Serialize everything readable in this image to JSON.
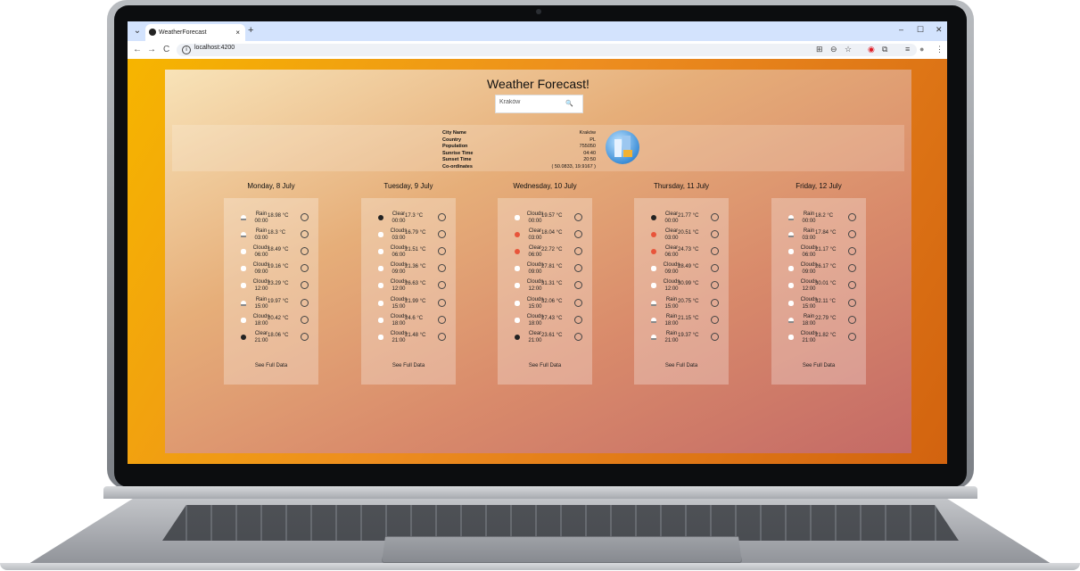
{
  "browser": {
    "tab_title": "WeatherForecast",
    "tab_close": "×",
    "new_tab": "+",
    "tab_menu": "⌄",
    "url": "localhost:4200",
    "back": "←",
    "forward": "→",
    "reload": "C",
    "minimize": "–",
    "maximize": "☐",
    "close": "✕",
    "tools": [
      "⊞",
      "⊖",
      "☆",
      "◉",
      "⧉",
      "≡",
      "●",
      "⋮"
    ]
  },
  "app": {
    "title": "Weather Forecast!",
    "search_value": "Kraków",
    "search_icon": "search-icon"
  },
  "city_info": [
    {
      "label": "City Name",
      "value": "Kraków"
    },
    {
      "label": "Country",
      "value": "PL"
    },
    {
      "label": "Population",
      "value": "755050"
    },
    {
      "label": "Sunrise Time",
      "value": "04:40"
    },
    {
      "label": "Sunset Time",
      "value": "20:50"
    },
    {
      "label": "Co-ordinates",
      "value": "( 50.0833, 19.9167 )"
    }
  ],
  "days": [
    {
      "title": "Monday, 8 July",
      "see_full_data": "See Full Data",
      "entries": [
        {
          "desc": "Rain",
          "time": "00:00",
          "temp": "18.98 °C",
          "icon": "rain"
        },
        {
          "desc": "Rain",
          "time": "03:00",
          "temp": "18.3 °C",
          "icon": "rain"
        },
        {
          "desc": "Clouds",
          "time": "06:00",
          "temp": "18.49 °C",
          "icon": "clouds"
        },
        {
          "desc": "Clouds",
          "time": "09:00",
          "temp": "19.16 °C",
          "icon": "clouds"
        },
        {
          "desc": "Clouds",
          "time": "12:00",
          "temp": "23.29 °C",
          "icon": "clouds"
        },
        {
          "desc": "Rain",
          "time": "15:00",
          "temp": "19.97 °C",
          "icon": "rain"
        },
        {
          "desc": "Clouds",
          "time": "18:00",
          "temp": "20.42 °C",
          "icon": "clouds"
        },
        {
          "desc": "Clear",
          "time": "21:00",
          "temp": "18.06 °C",
          "icon": "clear"
        }
      ]
    },
    {
      "title": "Tuesday, 9 July",
      "see_full_data": "See Full Data",
      "entries": [
        {
          "desc": "Clear",
          "time": "00:00",
          "temp": "17.3 °C",
          "icon": "clear"
        },
        {
          "desc": "Clouds",
          "time": "03:00",
          "temp": "16.79 °C",
          "icon": "clouds"
        },
        {
          "desc": "Clouds",
          "time": "06:00",
          "temp": "21.51 °C",
          "icon": "clouds"
        },
        {
          "desc": "Clouds",
          "time": "09:00",
          "temp": "21.36 °C",
          "icon": "clouds"
        },
        {
          "desc": "Clouds",
          "time": "12:00",
          "temp": "26.63 °C",
          "icon": "clouds"
        },
        {
          "desc": "Clouds",
          "time": "15:00",
          "temp": "21.99 °C",
          "icon": "clouds"
        },
        {
          "desc": "Clouds",
          "time": "18:00",
          "temp": "24.6 °C",
          "icon": "clouds"
        },
        {
          "desc": "Clouds",
          "time": "21:00",
          "temp": "21.48 °C",
          "icon": "clouds"
        }
      ]
    },
    {
      "title": "Wednesday, 10 July",
      "see_full_data": "See Full Data",
      "entries": [
        {
          "desc": "Clouds",
          "time": "00:00",
          "temp": "19.57 °C",
          "icon": "clouds"
        },
        {
          "desc": "Clear",
          "time": "03:00",
          "temp": "18.04 °C",
          "icon": "clear-red"
        },
        {
          "desc": "Clear",
          "time": "06:00",
          "temp": "22.72 °C",
          "icon": "clear-red"
        },
        {
          "desc": "Clouds",
          "time": "09:00",
          "temp": "27.81 °C",
          "icon": "clouds"
        },
        {
          "desc": "Clouds",
          "time": "12:00",
          "temp": "31.31 °C",
          "icon": "clouds"
        },
        {
          "desc": "Clouds",
          "time": "15:00",
          "temp": "32.06 °C",
          "icon": "clouds"
        },
        {
          "desc": "Clouds",
          "time": "18:00",
          "temp": "27.43 °C",
          "icon": "clouds"
        },
        {
          "desc": "Clear",
          "time": "21:00",
          "temp": "23.61 °C",
          "icon": "clear"
        }
      ]
    },
    {
      "title": "Thursday, 11 July",
      "see_full_data": "See Full Data",
      "entries": [
        {
          "desc": "Clear",
          "time": "00:00",
          "temp": "21.77 °C",
          "icon": "clear"
        },
        {
          "desc": "Clear",
          "time": "03:00",
          "temp": "20.51 °C",
          "icon": "clear-red"
        },
        {
          "desc": "Clear",
          "time": "06:00",
          "temp": "24.73 °C",
          "icon": "clear-red"
        },
        {
          "desc": "Clouds",
          "time": "09:00",
          "temp": "28.49 °C",
          "icon": "clouds"
        },
        {
          "desc": "Clouds",
          "time": "12:00",
          "temp": "30.99 °C",
          "icon": "clouds"
        },
        {
          "desc": "Rain",
          "time": "15:00",
          "temp": "20.75 °C",
          "icon": "rain"
        },
        {
          "desc": "Rain",
          "time": "18:00",
          "temp": "21.15 °C",
          "icon": "rain"
        },
        {
          "desc": "Rain",
          "time": "21:00",
          "temp": "19.37 °C",
          "icon": "rain"
        }
      ]
    },
    {
      "title": "Friday, 12 July",
      "see_full_data": "See Full Data",
      "entries": [
        {
          "desc": "Rain",
          "time": "00:00",
          "temp": "18.2 °C",
          "icon": "rain"
        },
        {
          "desc": "Rain",
          "time": "03:00",
          "temp": "17.84 °C",
          "icon": "rain"
        },
        {
          "desc": "Clouds",
          "time": "06:00",
          "temp": "21.17 °C",
          "icon": "clouds"
        },
        {
          "desc": "Clouds",
          "time": "09:00",
          "temp": "26.17 °C",
          "icon": "clouds"
        },
        {
          "desc": "Clouds",
          "time": "12:00",
          "temp": "30.01 °C",
          "icon": "clouds"
        },
        {
          "desc": "Clouds",
          "time": "15:00",
          "temp": "32.11 °C",
          "icon": "clouds"
        },
        {
          "desc": "Rain",
          "time": "18:00",
          "temp": "22.79 °C",
          "icon": "rain"
        },
        {
          "desc": "Clouds",
          "time": "21:00",
          "temp": "21.82 °C",
          "icon": "clouds"
        }
      ]
    }
  ]
}
